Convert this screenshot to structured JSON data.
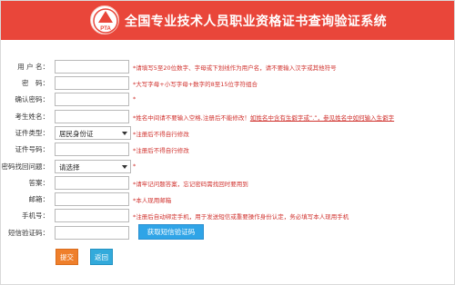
{
  "header": {
    "logo_text": "PTA",
    "title": "全国专业技术人员职业资格证书查询验证系统"
  },
  "colors": {
    "header_bg": "#e9463a",
    "hint": "#d0312d",
    "submit": "#ef7f2b",
    "back": "#33aadb",
    "sms": "#2fa4e7"
  },
  "form": {
    "username": {
      "label": "用 户 名：",
      "value": "",
      "hint": "*请填写5至20位数字、字母或下划线作为用户名，请不要输入汉字或其他符号"
    },
    "password": {
      "label": "密　码：",
      "value": "",
      "hint": "*大写字母+小写字母+数字的8至15位字符组合"
    },
    "confirm_password": {
      "label": "确认密码：",
      "value": "",
      "hint": "*"
    },
    "name": {
      "label": "考生姓名：",
      "value": "",
      "hint": "*姓名中间请不要输入空格,注册后不能修改！",
      "hint_link": "如姓名中含有生僻字或“.”，参见姓名中如何输入生僻字"
    },
    "id_type": {
      "label": "证件类型：",
      "value": "居民身份证",
      "hint": "*注册后不得自行修改"
    },
    "id_number": {
      "label": "证件号码：",
      "value": "",
      "hint": "*注册后不得自行修改"
    },
    "security_question": {
      "label": "密码找回问题：",
      "value": "请选择",
      "hint": "*"
    },
    "answer": {
      "label": "答案：",
      "value": "",
      "hint": "*请牢记问题答案，忘记密码需找回时要用到"
    },
    "email": {
      "label": "邮箱：",
      "value": "",
      "hint": "*本人现用邮箱"
    },
    "phone": {
      "label": "手机号：",
      "value": "",
      "hint": "*注册后自动绑定手机，用于发送短信或重要操作身份认定，务必填写本人现用手机"
    },
    "sms_code": {
      "label": "短信验证码：",
      "value": "",
      "button": "获取短信验证码"
    }
  },
  "actions": {
    "submit": "提交",
    "back": "返回"
  }
}
